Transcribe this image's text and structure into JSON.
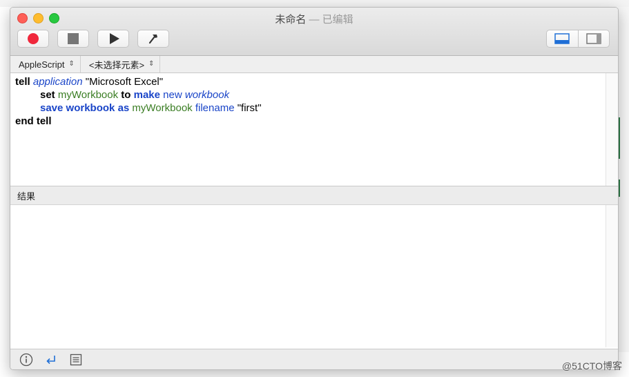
{
  "window": {
    "title": "未命名",
    "title_separator": " — ",
    "edited_status": "已编辑"
  },
  "toolbar": {
    "record_icon": "record-icon",
    "stop_icon": "stop-icon",
    "run_icon": "play-icon",
    "compile_icon": "hammer-icon",
    "view_bottom_icon": "bottom-pane-icon",
    "view_side_icon": "side-pane-icon"
  },
  "navbar": {
    "language": "AppleScript",
    "element": "<未选择元素>"
  },
  "script": {
    "line1": {
      "kw1": "tell",
      "cls": "application",
      "str": "\"Microsoft Excel\""
    },
    "line2": {
      "kw1": "set",
      "var1": "myWorkbook",
      "kw2": "to",
      "kw3": "make",
      "prop1": "new",
      "cls": "workbook"
    },
    "line3": {
      "kw1": "save",
      "kw2": "workbook",
      "kw3": "as",
      "var1": "myWorkbook",
      "prop1": "filename",
      "str": "\"first\""
    },
    "line4": {
      "kw1": "end tell"
    }
  },
  "results": {
    "label": "结果"
  },
  "bottom": {
    "info_icon": "info-icon",
    "reply_icon": "return-arrow-icon",
    "log_icon": "list-icon"
  },
  "watermark": "@51CTO博客",
  "colors": {
    "keyword_blue": "#1a45c8",
    "variable_green": "#3a7d23",
    "record_red": "#f0283c"
  }
}
